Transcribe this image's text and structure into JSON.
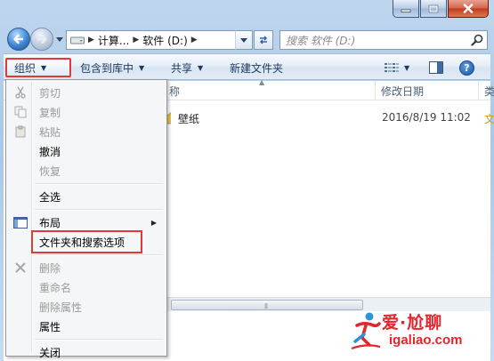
{
  "address": {
    "crumbs": [
      "计算...",
      "软件 (D:)"
    ]
  },
  "search": {
    "placeholder": "搜索 软件 (D:)"
  },
  "toolbar": {
    "organize": "组织",
    "include_in_library": "包含到库中",
    "share": "共享",
    "new_folder": "新建文件夹"
  },
  "columns": {
    "name": "称",
    "date_modified": "修改日期",
    "type": "类"
  },
  "files": [
    {
      "name": "壁纸",
      "date": "2016/8/19 11:02",
      "type": "文"
    }
  ],
  "menu": {
    "items": [
      {
        "label": "剪切",
        "enabled": false,
        "icon": "scissors-icon"
      },
      {
        "label": "复制",
        "enabled": false,
        "icon": "copy-icon"
      },
      {
        "label": "粘贴",
        "enabled": false,
        "icon": "paste-icon"
      },
      {
        "label": "撤消",
        "enabled": true
      },
      {
        "label": "恢复",
        "enabled": false
      },
      {
        "label": "全选",
        "enabled": true
      },
      {
        "label": "布局",
        "enabled": true,
        "icon": "layout-icon",
        "submenu": true
      },
      {
        "label": "文件夹和搜索选项",
        "enabled": true,
        "highlighted": true
      },
      {
        "label": "删除",
        "enabled": false,
        "icon": "delete-x-icon"
      },
      {
        "label": "重命名",
        "enabled": false
      },
      {
        "label": "删除属性",
        "enabled": false
      },
      {
        "label": "属性",
        "enabled": true
      },
      {
        "label": "关闭",
        "enabled": true
      }
    ]
  },
  "watermark": {
    "line1": "爱·尬聊",
    "line2": "igaliao.com"
  },
  "colors": {
    "highlight_box": "#e13a36",
    "watermark": "#e6242b",
    "toolbar_text": "#1e395b"
  }
}
